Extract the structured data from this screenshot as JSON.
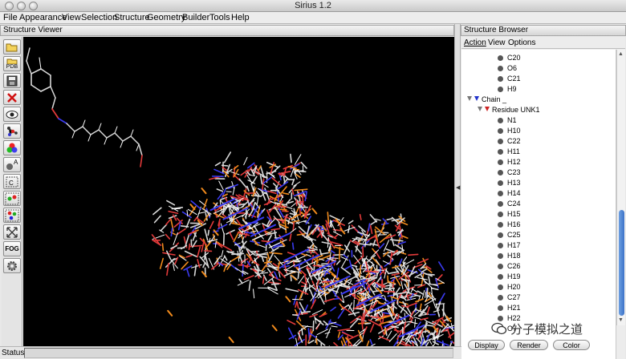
{
  "window": {
    "title": "Sirius 1.2"
  },
  "menubar": {
    "items": [
      {
        "label": "File"
      },
      {
        "label": "Appearance"
      },
      {
        "label": "View"
      },
      {
        "label": "Selection"
      },
      {
        "label": "Structure"
      },
      {
        "label": "Geometry"
      },
      {
        "label": "Builder"
      },
      {
        "label": "Tools"
      },
      {
        "label": "Help"
      }
    ]
  },
  "viewer": {
    "title": "Structure Viewer",
    "toolbar": [
      {
        "icon": "open-folder-icon"
      },
      {
        "icon": "pdb-icon",
        "label": "PDB"
      },
      {
        "icon": "save-icon"
      },
      {
        "icon": "close-icon"
      },
      {
        "icon": "eye-icon"
      },
      {
        "icon": "molecule-icon"
      },
      {
        "icon": "color-wheel-icon"
      },
      {
        "icon": "atom-label-icon",
        "label": "A"
      },
      {
        "icon": "atom-c-label-icon",
        "label": "C"
      },
      {
        "icon": "atom-select-icon"
      },
      {
        "icon": "atom-group-icon"
      },
      {
        "icon": "fit-view-icon"
      },
      {
        "icon": "fog-icon",
        "label": "FOG"
      },
      {
        "icon": "gear-icon"
      }
    ]
  },
  "browser": {
    "title": "Structure Browser",
    "menu": [
      {
        "label": "Action"
      },
      {
        "label": "View"
      },
      {
        "label": "Options"
      }
    ],
    "tree": {
      "top_atoms": [
        "C20",
        "O6",
        "C21",
        "H9"
      ],
      "chain_label": "Chain _",
      "residue_label": "Residue UNK1",
      "residue_atoms": [
        "N1",
        "H10",
        "C22",
        "H11",
        "H12",
        "C23",
        "H13",
        "H14",
        "C24",
        "H15",
        "H16",
        "C25",
        "H17",
        "H18",
        "C26",
        "H19",
        "H20",
        "C27",
        "H21",
        "H22",
        "O7"
      ]
    },
    "buttons": {
      "display": "Display",
      "render": "Render",
      "color": "Color"
    }
  },
  "status": {
    "label": "Status:",
    "text": ""
  },
  "watermark": {
    "text": "分子模拟之道"
  },
  "colors": {
    "viewer_bg": "#000000",
    "carbon": "#d8d8d8",
    "oxygen": "#e23a3a",
    "nitrogen": "#3a3af0",
    "phosphorus": "#f08a1c",
    "hydrogen": "#ffffff",
    "scroll_thumb": "#4a7fd0"
  }
}
